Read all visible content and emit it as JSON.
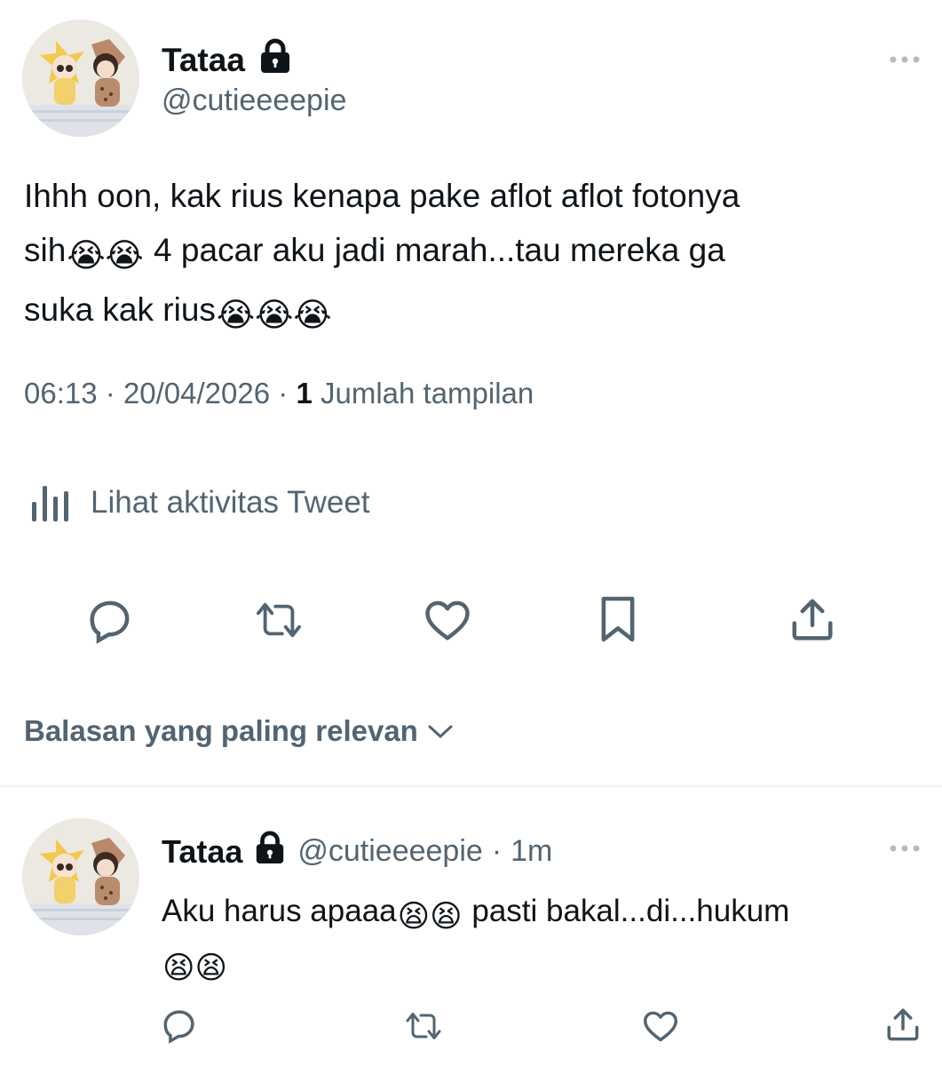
{
  "tweet": {
    "author": {
      "name": "Tataa",
      "handle": "@cutieeeepie"
    },
    "text_lines": [
      "Ihhh oon, kak rius kenapa pake aflot aflot fotonya",
      "sih",
      "😭😭",
      " 4 pacar aku jadi marah...tau mereka ga",
      "suka kak rius",
      "😭😭😭"
    ],
    "time": "06:13",
    "date": "20/04/2026",
    "views_count": "1",
    "views_label": "Jumlah tampilan",
    "separator": "·",
    "activity_label": "Lihat aktivitas Tweet"
  },
  "replies_sort": {
    "label": "Balasan yang paling relevan"
  },
  "reply": {
    "author": {
      "name": "Tataa",
      "handle": "@cutieeeepie"
    },
    "separator": "·",
    "time_ago": "1m",
    "text_part1": "Aku harus apaaa",
    "emoji1": "😫😫",
    "text_part2": " pasti bakal...di...hukum",
    "emoji2": "😫😫"
  },
  "colors": {
    "text_primary": "#0f1419",
    "text_secondary": "#536471",
    "divider": "#eff3f4",
    "icon": "#536471"
  },
  "icons": {
    "lock": "lock-icon",
    "more": "more-horizontal-icon",
    "analytics": "bar-chart-icon",
    "reply": "reply-bubble-icon",
    "retweet": "retweet-icon",
    "like": "heart-icon",
    "bookmark": "bookmark-icon",
    "share": "share-icon",
    "chevron": "chevron-down-icon"
  }
}
